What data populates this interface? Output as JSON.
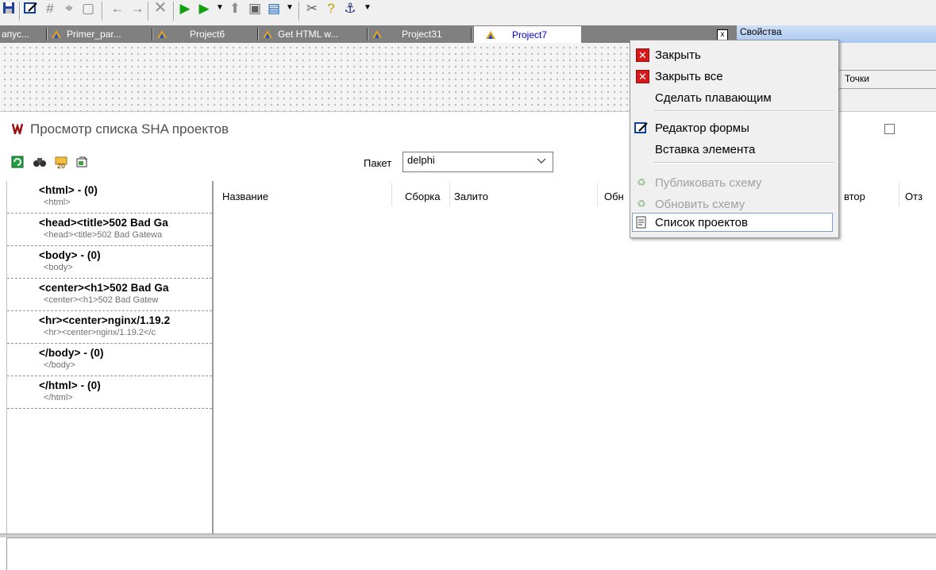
{
  "toolbar": {
    "icons": [
      "save-icon",
      "form-icon",
      "grid-icon",
      "align-icon",
      "frame-icon",
      "arrow-left-icon",
      "arrow-right-icon",
      "delete-icon",
      "run-icon",
      "debug-run-icon",
      "step-icon",
      "window-icon",
      "compile-icon",
      "tools-icon",
      "help-icon",
      "anchor-icon"
    ]
  },
  "tabs": {
    "items": [
      {
        "label": "апус..."
      },
      {
        "label": "Primer_par..."
      },
      {
        "label": "Project6"
      },
      {
        "label": "Get HTML w..."
      },
      {
        "label": "Project31"
      },
      {
        "label": "Project7"
      }
    ],
    "close_glyph": "x"
  },
  "properties": {
    "title": "Свойства",
    "column_points": "Точки"
  },
  "sha_window": {
    "title": "Просмотр списка SHA проектов",
    "package_label": "Пакет",
    "package_value": "delphi",
    "tools": [
      "refresh-icon",
      "find-icon",
      "folder-20-icon",
      "export-icon"
    ]
  },
  "tree": {
    "items": [
      {
        "main": "<html> - (0)",
        "sub": "<html>"
      },
      {
        "main": "<head><title>502 Bad Ga",
        "sub": "<head><title>502 Bad Gatewa"
      },
      {
        "main": "<body> - (0)",
        "sub": "<body>"
      },
      {
        "main": "<center><h1>502 Bad Ga",
        "sub": "<center><h1>502 Bad Gatew"
      },
      {
        "main": "<hr><center>nginx/1.19.2",
        "sub": "<hr><center>nginx/1.19.2</c"
      },
      {
        "main": "</body> - (0)",
        "sub": "</body>"
      },
      {
        "main": "</html> - (0)",
        "sub": "</html>"
      }
    ]
  },
  "list": {
    "columns": [
      {
        "label": "Название"
      },
      {
        "label": "Сборка"
      },
      {
        "label": "Залито"
      },
      {
        "label": "Обн"
      },
      {
        "label": "втор"
      },
      {
        "label": "Отз"
      }
    ]
  },
  "context_menu": {
    "items": [
      {
        "label": "Закрыть",
        "enabled": true
      },
      {
        "label": "Закрыть все",
        "enabled": true
      },
      {
        "label": "Сделать плавающим",
        "enabled": true
      },
      {
        "label": "Редактор формы",
        "enabled": true
      },
      {
        "label": "Вставка элемента",
        "enabled": true
      },
      {
        "label": "Публиковать схему",
        "enabled": false
      },
      {
        "label": "Обновить схему",
        "enabled": false
      },
      {
        "label": "Список проектов",
        "enabled": true
      }
    ]
  },
  "colors": {
    "accent": "#0000cc",
    "tab_bg": "#808080",
    "prop_header": "#a9c8ee",
    "close_red": "#d81818"
  }
}
